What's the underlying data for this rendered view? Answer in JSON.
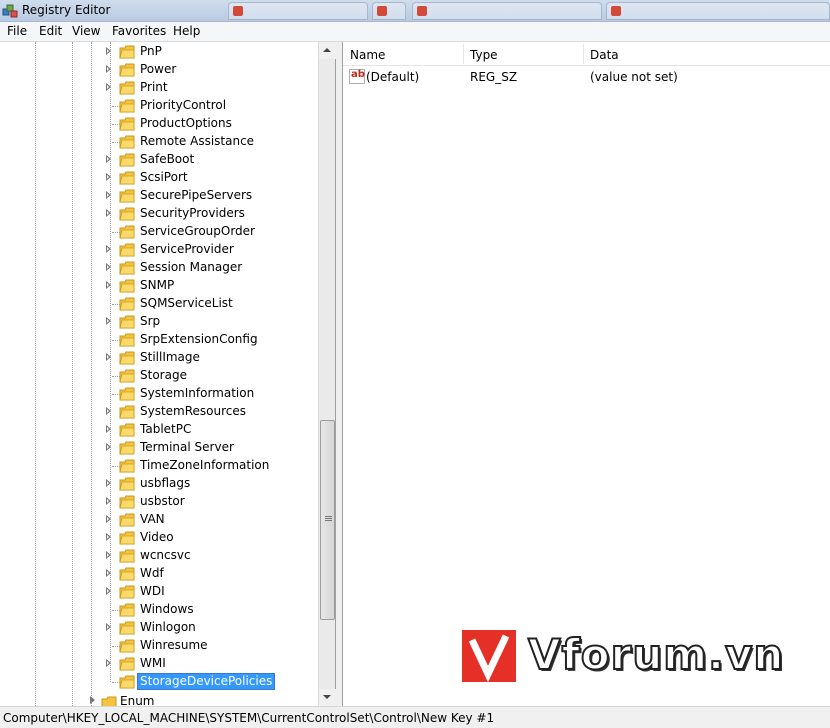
{
  "window": {
    "title": "Registry Editor"
  },
  "menu": [
    "File",
    "Edit",
    "View",
    "Favorites",
    "Help"
  ],
  "tree": {
    "items": [
      {
        "label": "PnP",
        "expandable": true
      },
      {
        "label": "Power",
        "expandable": true
      },
      {
        "label": "Print",
        "expandable": true
      },
      {
        "label": "PriorityControl",
        "expandable": false
      },
      {
        "label": "ProductOptions",
        "expandable": false
      },
      {
        "label": "Remote Assistance",
        "expandable": false
      },
      {
        "label": "SafeBoot",
        "expandable": true
      },
      {
        "label": "ScsiPort",
        "expandable": true
      },
      {
        "label": "SecurePipeServers",
        "expandable": true
      },
      {
        "label": "SecurityProviders",
        "expandable": true
      },
      {
        "label": "ServiceGroupOrder",
        "expandable": false
      },
      {
        "label": "ServiceProvider",
        "expandable": true
      },
      {
        "label": "Session Manager",
        "expandable": true
      },
      {
        "label": "SNMP",
        "expandable": true
      },
      {
        "label": "SQMServiceList",
        "expandable": false
      },
      {
        "label": "Srp",
        "expandable": true
      },
      {
        "label": "SrpExtensionConfig",
        "expandable": false
      },
      {
        "label": "StillImage",
        "expandable": true
      },
      {
        "label": "Storage",
        "expandable": false
      },
      {
        "label": "SystemInformation",
        "expandable": false
      },
      {
        "label": "SystemResources",
        "expandable": true
      },
      {
        "label": "TabletPC",
        "expandable": true
      },
      {
        "label": "Terminal Server",
        "expandable": true
      },
      {
        "label": "TimeZoneInformation",
        "expandable": false
      },
      {
        "label": "usbflags",
        "expandable": true
      },
      {
        "label": "usbstor",
        "expandable": true
      },
      {
        "label": "VAN",
        "expandable": true
      },
      {
        "label": "Video",
        "expandable": true
      },
      {
        "label": "wcncsvc",
        "expandable": true
      },
      {
        "label": "Wdf",
        "expandable": true
      },
      {
        "label": "WDI",
        "expandable": true
      },
      {
        "label": "Windows",
        "expandable": false
      },
      {
        "label": "Winlogon",
        "expandable": true
      },
      {
        "label": "Winresume",
        "expandable": false
      },
      {
        "label": "WMI",
        "expandable": true
      }
    ],
    "editing_label": "StorageDevicePolicies",
    "partial_label": "Enum"
  },
  "list": {
    "columns": [
      "Name",
      "Type",
      "Data"
    ],
    "rows": [
      {
        "name": "(Default)",
        "type": "REG_SZ",
        "data": "(value not set)"
      }
    ]
  },
  "watermark": {
    "text": "Vforum.vn"
  },
  "status": {
    "path": "Computer\\HKEY_LOCAL_MACHINE\\SYSTEM\\CurrentControlSet\\Control\\New Key #1"
  },
  "colors": {
    "selection": "#3399ff",
    "folder": "#f5c342",
    "watermark_red": "#e53027"
  }
}
